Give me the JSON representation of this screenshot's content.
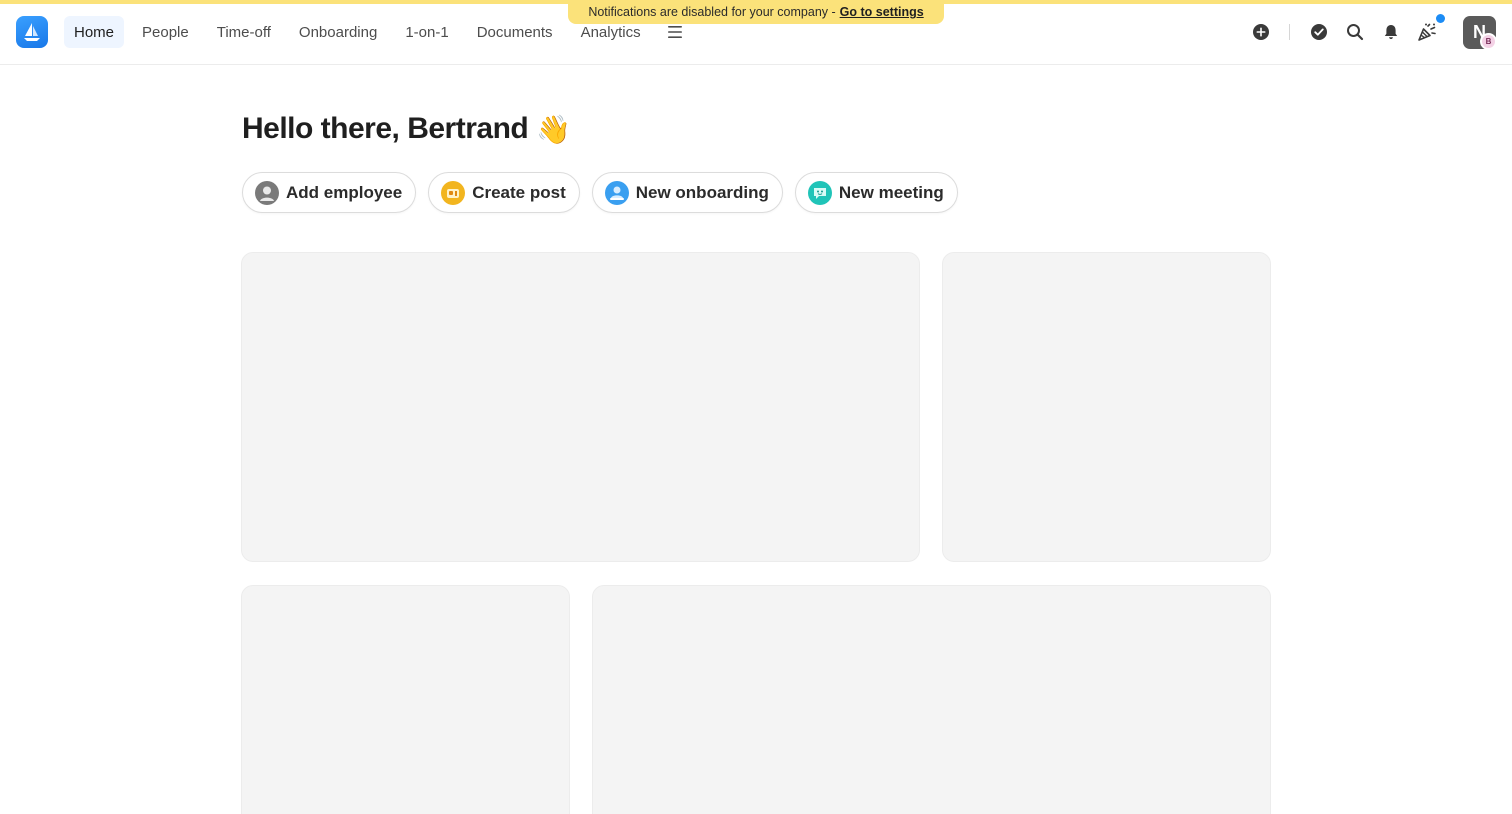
{
  "banner": {
    "text": "Notifications are disabled for your company -",
    "link_label": "Go to settings"
  },
  "nav": {
    "items": [
      {
        "label": "Home",
        "active": true
      },
      {
        "label": "People"
      },
      {
        "label": "Time-off"
      },
      {
        "label": "Onboarding"
      },
      {
        "label": "1-on-1"
      },
      {
        "label": "Documents"
      },
      {
        "label": "Analytics"
      }
    ]
  },
  "user": {
    "avatar_initial": "N",
    "badge_initial": "B"
  },
  "greeting": {
    "text": "Hello there, Bertrand",
    "emoji": "👋"
  },
  "actions": [
    {
      "label": "Add employee",
      "icon": "person-icon",
      "color": "#7a7a7a"
    },
    {
      "label": "Create post",
      "icon": "mailbox-icon",
      "color": "#f2b51f"
    },
    {
      "label": "New onboarding",
      "icon": "onboarding-icon",
      "color": "#3a9ff0"
    },
    {
      "label": "New meeting",
      "icon": "meeting-icon",
      "color": "#20c4b8"
    }
  ],
  "colors": {
    "accent": "#1c8cf5",
    "banner": "#fbe27a",
    "card_placeholder": "#f4f4f4"
  }
}
